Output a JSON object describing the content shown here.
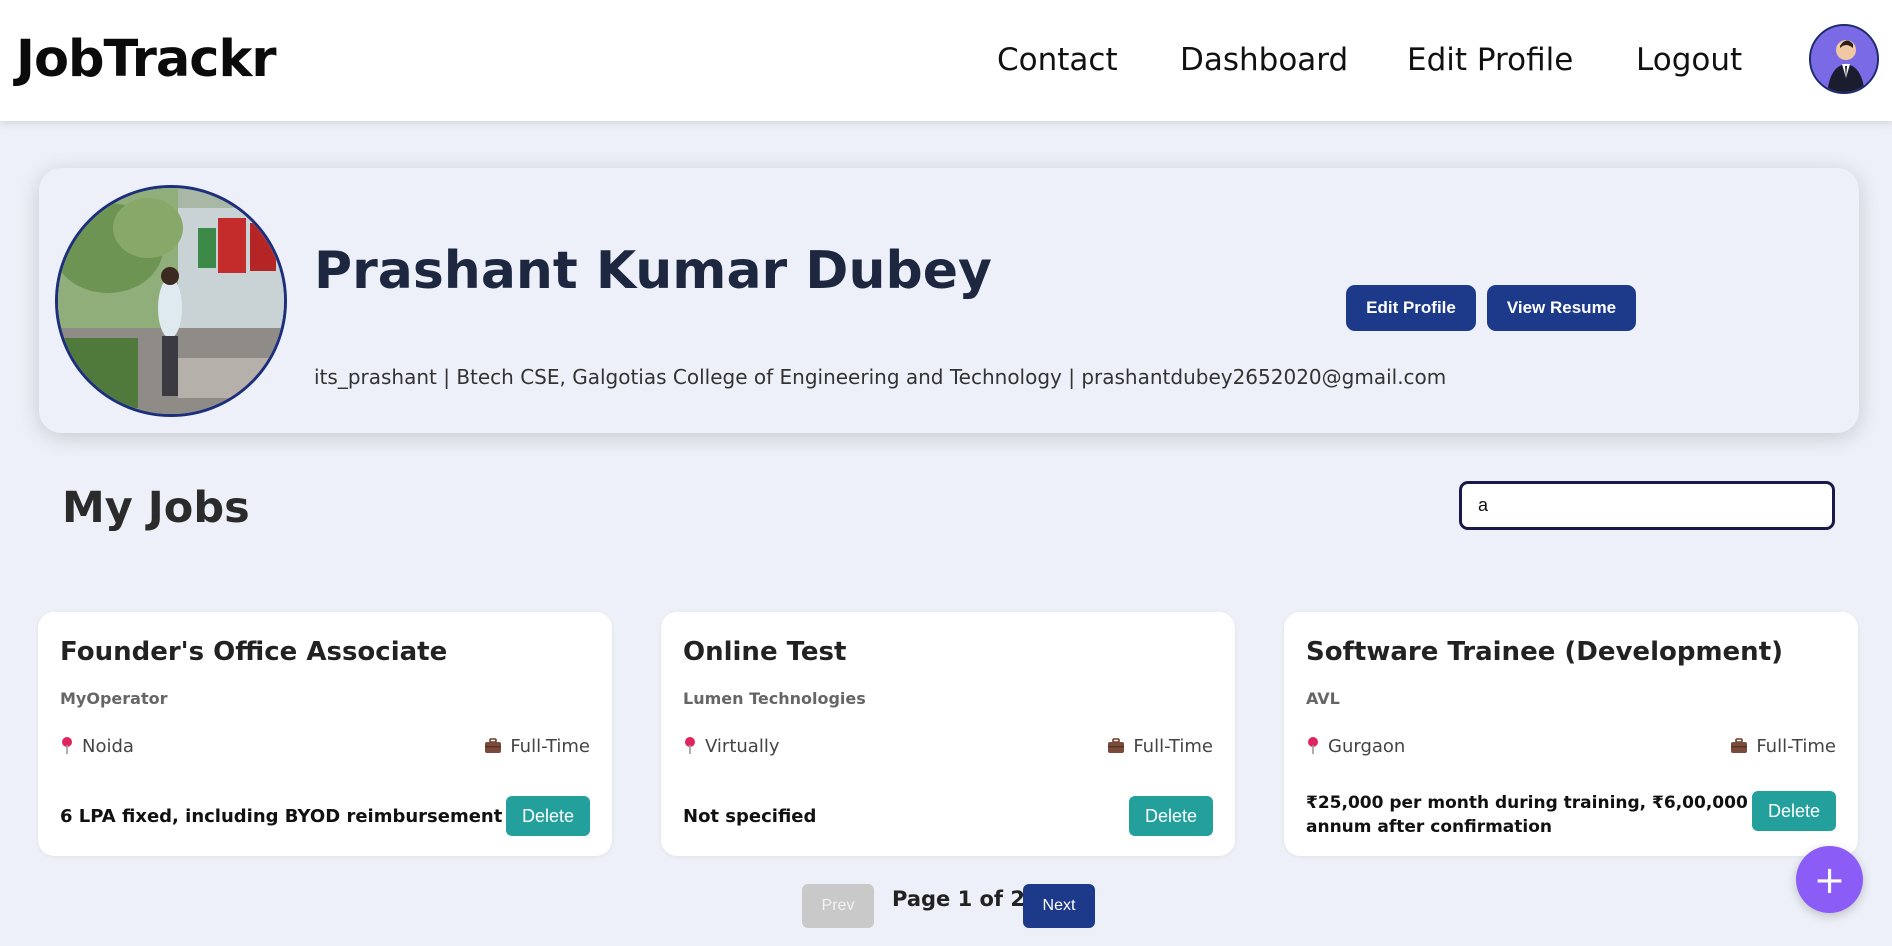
{
  "header": {
    "brand": "JobTrackr",
    "nav": {
      "contact": "Contact",
      "dashboard": "Dashboard",
      "edit_profile": "Edit Profile",
      "logout": "Logout"
    }
  },
  "profile": {
    "name": "Prashant Kumar Dubey",
    "meta": "its_prashant | Btech CSE, Galgotias College of Engineering and Technology | prashantdubey2652020@gmail.com",
    "edit_button": "Edit Profile",
    "resume_button": "View Resume"
  },
  "jobs_section": {
    "title": "My Jobs",
    "search_value": "a"
  },
  "jobs": [
    {
      "title": "Founder's Office Associate",
      "company": "MyOperator",
      "location": "Noida",
      "type": "Full-Time",
      "salary": "6 LPA fixed, including BYOD reimbursement",
      "delete_label": "Delete"
    },
    {
      "title": "Online Test",
      "company": "Lumen Technologies",
      "location": "Virtually",
      "type": "Full-Time",
      "salary": "Not specified",
      "delete_label": "Delete"
    },
    {
      "title": "Software Trainee (Development)",
      "company": "AVL",
      "location": "Gurgaon",
      "type": "Full-Time",
      "salary_line1": "₹25,000 per month during training, ₹6,00,000 per",
      "salary_line2": "annum after confirmation",
      "delete_label": "Delete"
    }
  ],
  "pagination": {
    "prev": "Prev",
    "indicator": "Page 1 of 2",
    "next": "Next"
  },
  "fab_label": "+",
  "colors": {
    "primary": "#1d3a8a",
    "delete": "#23a09c",
    "fab": "#8b5cf6",
    "background": "#edf0f8"
  },
  "icons": {
    "location": "map-pin-icon",
    "job_type": "briefcase-icon"
  }
}
